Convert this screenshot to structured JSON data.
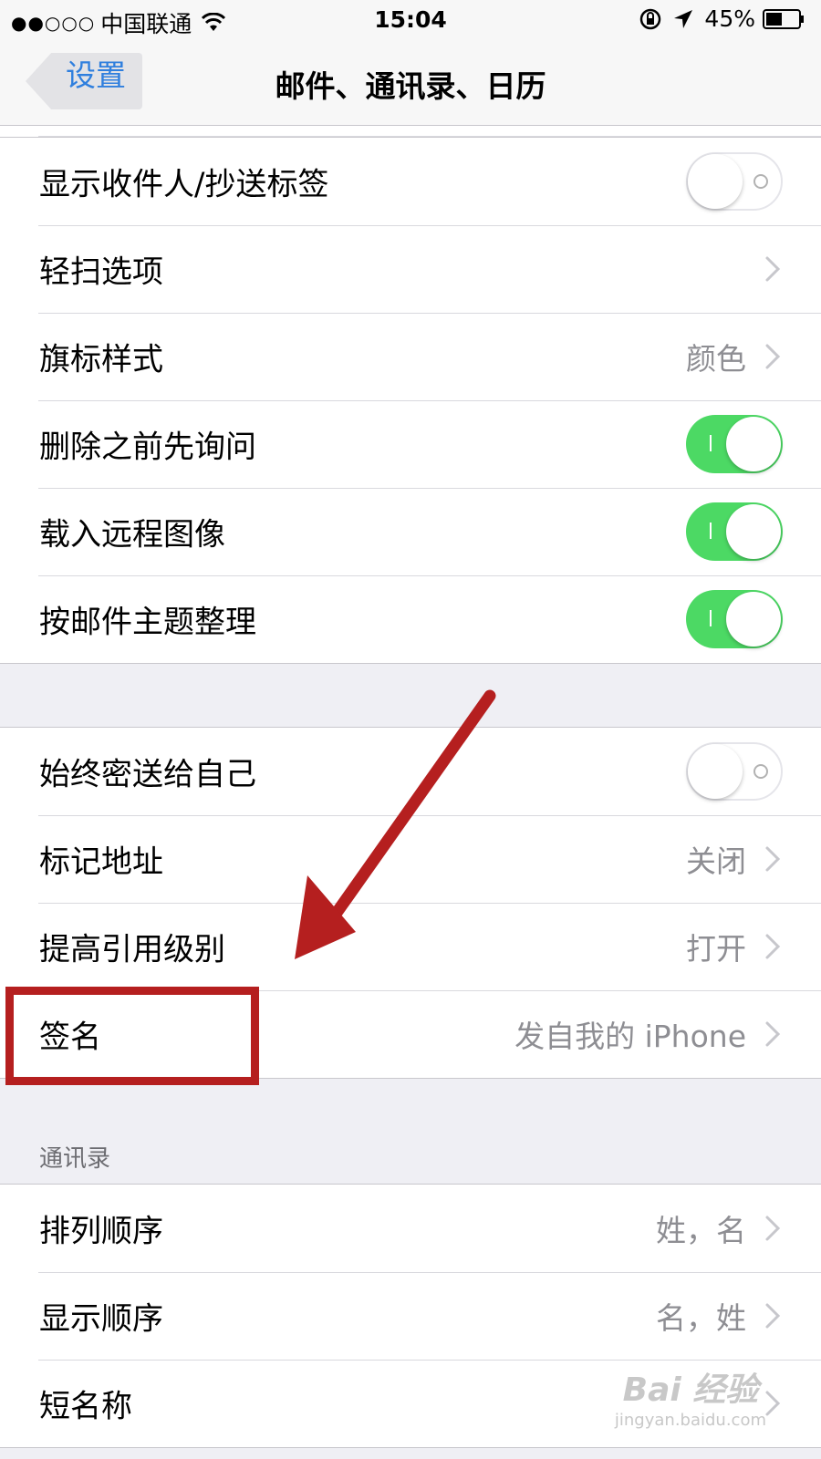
{
  "status_bar": {
    "signal": "●●○○○",
    "carrier": "中国联通",
    "time": "15:04",
    "battery": "45%"
  },
  "nav": {
    "back_label": "设置",
    "title": "邮件、通讯录、日历"
  },
  "mail_group_1": [
    {
      "label": "显示收件人/抄送标签",
      "type": "toggle",
      "on": false
    },
    {
      "label": "轻扫选项",
      "type": "link",
      "value": ""
    },
    {
      "label": "旗标样式",
      "type": "link",
      "value": "颜色"
    },
    {
      "label": "删除之前先询问",
      "type": "toggle",
      "on": true
    },
    {
      "label": "载入远程图像",
      "type": "toggle",
      "on": true
    },
    {
      "label": "按邮件主题整理",
      "type": "toggle",
      "on": true
    }
  ],
  "mail_group_2": [
    {
      "label": "始终密送给自己",
      "type": "toggle",
      "on": false
    },
    {
      "label": "标记地址",
      "type": "link",
      "value": "关闭"
    },
    {
      "label": "提高引用级别",
      "type": "link",
      "value": "打开"
    },
    {
      "label": "签名",
      "type": "link",
      "value": "发自我的 iPhone"
    }
  ],
  "contacts_section": {
    "header": "通讯录",
    "rows": [
      {
        "label": "排列顺序",
        "value": "姓，名"
      },
      {
        "label": "显示顺序",
        "value": "名，姓"
      },
      {
        "label": "短名称",
        "value": ""
      }
    ]
  },
  "colors": {
    "toggle_on": "#4cd964",
    "accent_blue": "#2f7fde",
    "annotation_red": "#b51f1f"
  },
  "watermark": {
    "logo": "Bai 经验",
    "url": "jingyan.baidu.com"
  }
}
